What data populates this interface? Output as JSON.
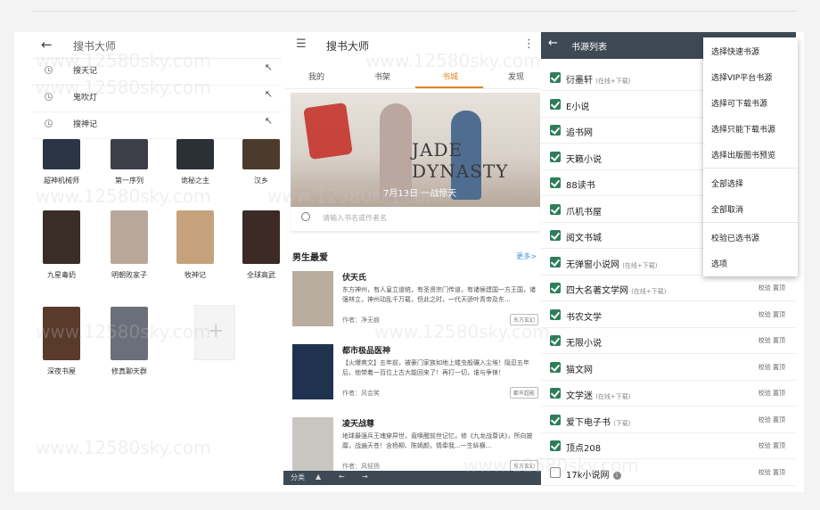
{
  "panel1": {
    "search_text": "搜书大师",
    "history": [
      "搜天记",
      "鬼吹灯",
      "搜神记"
    ],
    "books": [
      {
        "title": "超神机械师",
        "color": "#2a3444"
      },
      {
        "title": "第一序列",
        "color": "#3c3f48"
      },
      {
        "title": "诡秘之主",
        "color": "#2b2f36"
      },
      {
        "title": "汉乡",
        "color": "#4b3b2e"
      },
      {
        "title": "九星毒奶",
        "color": "#3a2d27"
      },
      {
        "title": "明朝败家子",
        "color": "#b8a89a"
      },
      {
        "title": "牧神记",
        "color": "#c6a27c"
      },
      {
        "title": "全球高武",
        "color": "#3b2a25"
      },
      {
        "title": "深夜书屋",
        "color": "#5a3a2a"
      },
      {
        "title": "修真聊天群",
        "color": "#6b6f79"
      }
    ]
  },
  "panel2": {
    "title": "搜书大师",
    "tabs": [
      "我的",
      "书架",
      "书城",
      "发现"
    ],
    "active_tab": "书城",
    "banner_title": "JADE DYNASTY",
    "banner_date": "7月13日 一战惊天",
    "search_placeholder": "请输入书名或作者名",
    "section_title": "男生最爱",
    "section_more": "更多>",
    "items": [
      {
        "title": "伏天氏",
        "desc": "东方神州，有人皇立道统，有圣贤宗门传道，有诸侯建国一方王国，诸强林立，神州动乱千万载，但此之时，一代天骄叶青帝及东...",
        "author": "作者：净无痕",
        "tag": "东方玄幻",
        "color": "#b9ada0"
      },
      {
        "title": "都市极品医神",
        "desc": "【火爆爽文】五年前，被豪门家族如地上蝼虫般碾入尘埃！隐忍五年后，他带着一百位上古大能回来了！再打一切，谁与争锋！",
        "author": "作者：风会笑",
        "tag": "都市超能",
        "color": "#1f3350"
      },
      {
        "title": "凌天战尊",
        "desc": "地球最强兵王魂穿异世，竟唤醒前世记忆，修《九龙战尊诀》，所向披靡，战遍天苍！含杨柳、陈嫣颜，情牵我...一生纵横...",
        "author": "作者：风轻扬",
        "tag": "东方玄幻",
        "color": "#c9c6c2"
      }
    ],
    "bottom": [
      "分类",
      "▲",
      "←",
      "→"
    ]
  },
  "panel3": {
    "title": "书源列表",
    "sources": [
      {
        "name": "衍墨轩",
        "note": "(在线+下载)",
        "checked": true,
        "ops": ""
      },
      {
        "name": "E小说",
        "note": "",
        "checked": true,
        "ops": ""
      },
      {
        "name": "追书网",
        "note": "",
        "checked": true,
        "ops": ""
      },
      {
        "name": "天籁小说",
        "note": "",
        "checked": true,
        "ops": ""
      },
      {
        "name": "88读书",
        "note": "",
        "checked": true,
        "ops": ""
      },
      {
        "name": "爪机书屋",
        "note": "",
        "checked": true,
        "ops": ""
      },
      {
        "name": "阅文书城",
        "note": "",
        "checked": true,
        "ops": ""
      },
      {
        "name": "无弹窗小说网",
        "note": "(在线+下载)",
        "checked": true,
        "ops": ""
      },
      {
        "name": "四大名著文学网",
        "note": "(在线+下载)",
        "checked": true,
        "ops": "校验  置顶"
      },
      {
        "name": "书农文学",
        "note": "",
        "checked": true,
        "ops": "校验  置顶"
      },
      {
        "name": "无限小说",
        "note": "",
        "checked": true,
        "ops": "校验  置顶"
      },
      {
        "name": "猫文网",
        "note": "",
        "checked": true,
        "ops": "校验  置顶"
      },
      {
        "name": "文学迷",
        "note": "(在线+下载)",
        "checked": true,
        "ops": "校验  置顶"
      },
      {
        "name": "爱下电子书",
        "note": "(下载)",
        "checked": true,
        "ops": "校验  置顶"
      },
      {
        "name": "顶点208",
        "note": "",
        "checked": true,
        "ops": "校验  置顶"
      },
      {
        "name": "17k小说网",
        "note": "",
        "checked": false,
        "ops": "校验  置顶"
      }
    ],
    "menu": [
      "选择快速书源",
      "选择VIP平台书源",
      "选择可下载书源",
      "选择只能下载书源",
      "选择出版图书预览",
      "全部选择",
      "全部取消",
      "校验已选书源",
      "选项"
    ]
  },
  "watermark": "www.12580sky.com"
}
